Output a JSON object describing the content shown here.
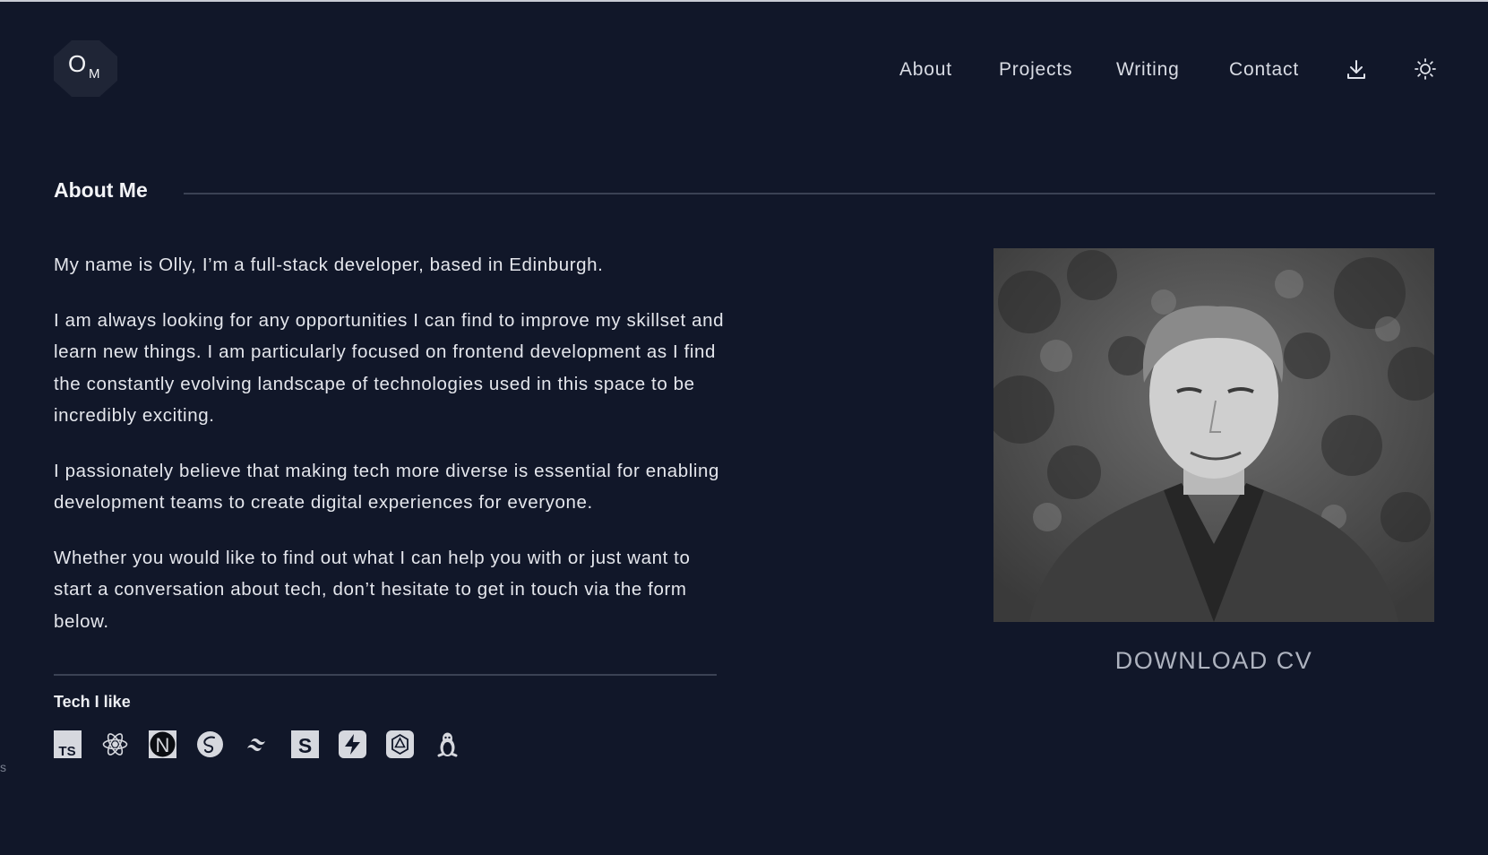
{
  "logo": {
    "big": "O",
    "small": "M"
  },
  "nav": {
    "items": [
      {
        "label": "About"
      },
      {
        "label": "Projects"
      },
      {
        "label": "Writing"
      },
      {
        "label": "Contact"
      }
    ],
    "download_icon": "download-icon",
    "theme_icon": "sun-icon"
  },
  "section": {
    "title": "About Me"
  },
  "bio": {
    "paragraphs": [
      "My name is Olly, I’m a full-stack developer, based in Edinburgh.",
      "I am always looking for any opportunities I can find to improve my skillset and learn new things. I am particularly focused on frontend development as I find the constantly evolving landscape of technologies used in this space to be incredibly exciting.",
      "I passionately believe that making tech more diverse is essential for enabling development teams to create digital experiences for everyone.",
      "Whether you would like to find out what I can help you with or just want to start a conversation about tech, don’t hesitate to get in touch via the form below."
    ]
  },
  "tech": {
    "title": "Tech I like",
    "icons": [
      {
        "name": "typescript-icon",
        "glyph": "TS"
      },
      {
        "name": "react-icon"
      },
      {
        "name": "nextjs-icon",
        "glyph": "N"
      },
      {
        "name": "sass-icon"
      },
      {
        "name": "tailwind-icon"
      },
      {
        "name": "styled-components-icon",
        "glyph": "S"
      },
      {
        "name": "supabase-icon"
      },
      {
        "name": "graphql-icon"
      },
      {
        "name": "linux-icon"
      }
    ]
  },
  "photo": {
    "alt": "portrait-photo"
  },
  "cta": {
    "download_cv": "DOWNLOAD CV"
  },
  "stray": "s"
}
